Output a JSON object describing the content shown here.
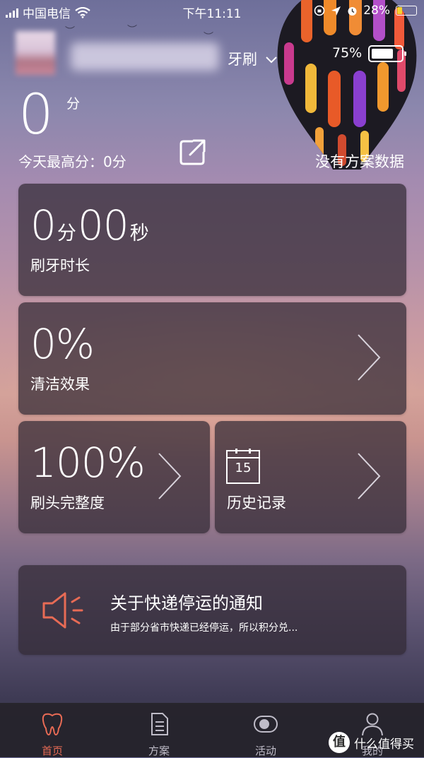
{
  "status_bar": {
    "carrier": "中国电信",
    "time": "下午11:11",
    "battery_percent": "28%"
  },
  "device": {
    "name": "牙刷",
    "battery_percent": "75%",
    "battery_level": 0.75
  },
  "score": {
    "value": "0",
    "unit": "分",
    "today_best_label": "今天最高分：",
    "today_best_value": "0分",
    "no_plan_text": "没有方案数据"
  },
  "brush_time": {
    "minutes": "0",
    "minutes_unit": "分",
    "seconds": "00",
    "seconds_unit": "秒",
    "label": "刷牙时长"
  },
  "clean": {
    "value": "0%",
    "label": "清洁效果"
  },
  "brush_head": {
    "value": "100%",
    "label": "刷头完整度"
  },
  "history": {
    "calendar_day": "15",
    "label": "历史记录"
  },
  "notice": {
    "title": "关于快递停运的通知",
    "subtitle": "由于部分省市快递已经停运，所以积分兑..."
  },
  "tabs": [
    {
      "label": "首页",
      "icon": "tooth-icon",
      "active": true
    },
    {
      "label": "方案",
      "icon": "document-icon",
      "active": false
    },
    {
      "label": "活动",
      "icon": "toggle-icon",
      "active": false
    },
    {
      "label": "我的",
      "icon": "person-icon",
      "active": false
    }
  ],
  "watermark": {
    "logo_char": "值",
    "text": "什么值得买"
  },
  "colors": {
    "accent": "#e86b55",
    "card_bg": "rgba(50,42,52,0.72)",
    "tab_inactive": "#bfbcc8"
  }
}
